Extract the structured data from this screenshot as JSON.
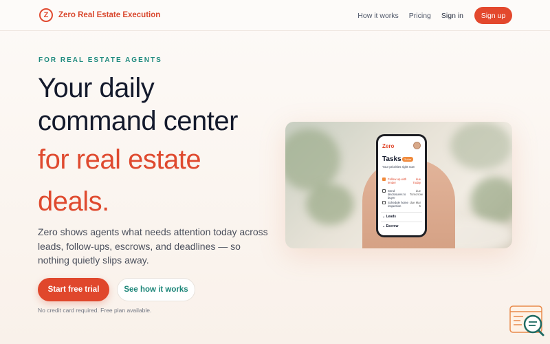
{
  "nav": {
    "brand_logo": "Z",
    "brand_name": "Zero Real Estate Execution",
    "links": [
      "How it works",
      "Pricing",
      "Sign in"
    ],
    "signup_label": "Sign up"
  },
  "hero": {
    "eyebrow": "FOR REAL ESTATE AGENTS",
    "headline_line1": "Your daily",
    "headline_line2": "command center",
    "headline_accent1": "for real estate",
    "headline_accent2": "deals.",
    "lede": "Zero shows agents what needs attention today across leads, follow-ups, escrows, and deadlines — so nothing quietly slips away.",
    "primary_cta": "Start free trial",
    "secondary_cta": "See how it works",
    "fineprint": "No credit card required. Free plan available."
  },
  "phone": {
    "logo": "Zero",
    "title": "Tasks",
    "badge": "3 due",
    "subtitle": "Your priorities right now",
    "tasks": [
      {
        "text": "Follow up with lender",
        "due": "due Today",
        "done": true
      },
      {
        "text": "Send disclosures to buyer",
        "due": "due Tomorrow",
        "done": false
      },
      {
        "text": "Schedule home inspection",
        "due": "due Mar 5",
        "done": false
      }
    ],
    "sections": [
      "Leads",
      "Escrow"
    ]
  },
  "colors": {
    "brand_accent": "#e0472c",
    "eyebrow_teal": "#1f8a7e",
    "heading": "#141a2c"
  },
  "icons": {
    "brand": "zero-logo-icon",
    "widget": "chat-search-icon"
  }
}
